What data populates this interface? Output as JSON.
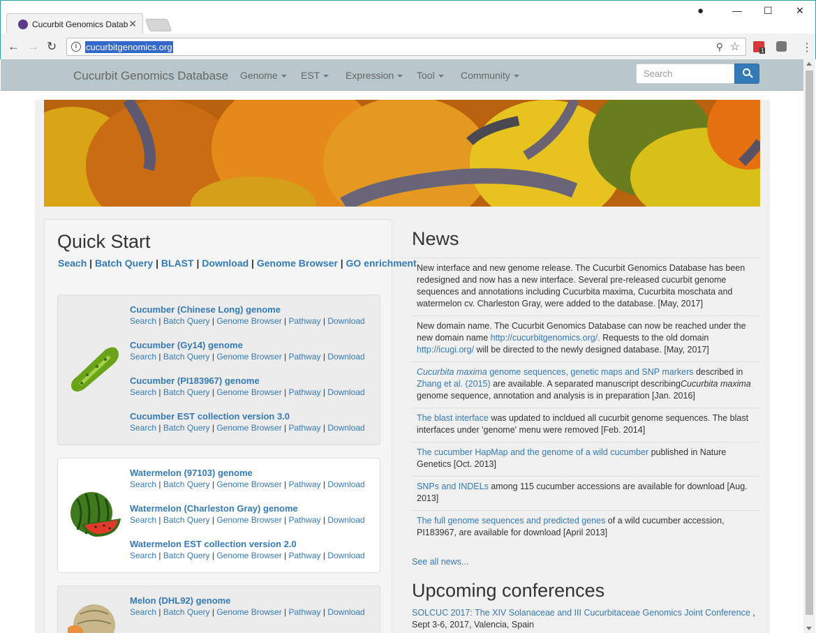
{
  "browser": {
    "tab_title": "Cucurbit Genomics Datab",
    "url": "cucurbitgenomics.org",
    "ext_badge": "1"
  },
  "navbar": {
    "brand": "Cucurbit Genomics Database",
    "items": [
      "Genome",
      "EST",
      "Expression",
      "Tool",
      "Community"
    ],
    "search_placeholder": "Search"
  },
  "quick_start": {
    "title": "Quick Start",
    "links": [
      "Seach",
      "Batch Query",
      "BLAST",
      "Download",
      "Genome Browser",
      "GO enrichment"
    ],
    "sub_links": [
      "Search",
      "Batch Query",
      "Genome Browser",
      "Pathway",
      "Download"
    ],
    "cucumber": [
      "Cucumber (Chinese Long) genome",
      "Cucumber (Gy14) genome",
      "Cucumber (PI183967) genome",
      "Cucumber EST collection version 3.0"
    ],
    "watermelon": [
      "Watermelon (97103) genome",
      "Watermelon (Charleston Gray) genome",
      "Watermelon EST collection version 2.0"
    ],
    "melon": [
      "Melon (DHL92) genome"
    ]
  },
  "news": {
    "title": "News",
    "item1": "New interface and new genome release. The Cucurbit Genomics Database has been redesigned and now has a new interface. Several pre-released cucurbit genome sequences and annotations including Cucurbita maxima, Cucurbita moschata and watermelon cv. Charleston Gray, were added to the database. [May, 2017]",
    "item2": {
      "t1": "New domain name. The Cucurbit Genomics Database can now be reached under the new domain name ",
      "l1": "http://cucurbitgenomics.org/.",
      "t2": " Requests to the old domain ",
      "l2": "http://icugi.org/",
      "t3": " will be directed to the newly designed database. [May, 2017]"
    },
    "item3": {
      "l1": "Cucurbita maxima",
      "l2": " genome sequences, genetic maps and SNP markers",
      "t1": " described in ",
      "l3": "Zhang et al. (2015)",
      "t2": " are available. A separated manuscript describing",
      "t3": "Cucurbita maxima",
      "t4": " genome sequence, annotation and analysis is in preparation [Jan. 2016]"
    },
    "item4": {
      "l1": "The blast interface",
      "t1": " was updated to incldued all cucurbit genome sequences. The blast interfaces under 'genome' menu were removed [Feb. 2014]"
    },
    "item5": {
      "l1": "The cucumber HapMap and the genome of a wild cucumber",
      "t1": " published in Nature Genetics [Oct. 2013]"
    },
    "item6": {
      "l1": "SNPs and INDELs",
      "t1": " among 115 cucumber accessions are available for download [Aug. 2013]"
    },
    "item7": {
      "l1": "The full genome sequences and predicted genes",
      "t1": " of a wild cucumber accession, PI183967, are available for download [April 2013]"
    },
    "see_all": "See all news..."
  },
  "conferences": {
    "title": "Upcoming conferences",
    "link": "SOLCUC 2017: The XIV Solanaceae and III Cucurbitaceae Genomics Joint Conference",
    "after_link": " ,",
    "detail": "Sept 3-6, 2017, Valencia, Spain"
  }
}
